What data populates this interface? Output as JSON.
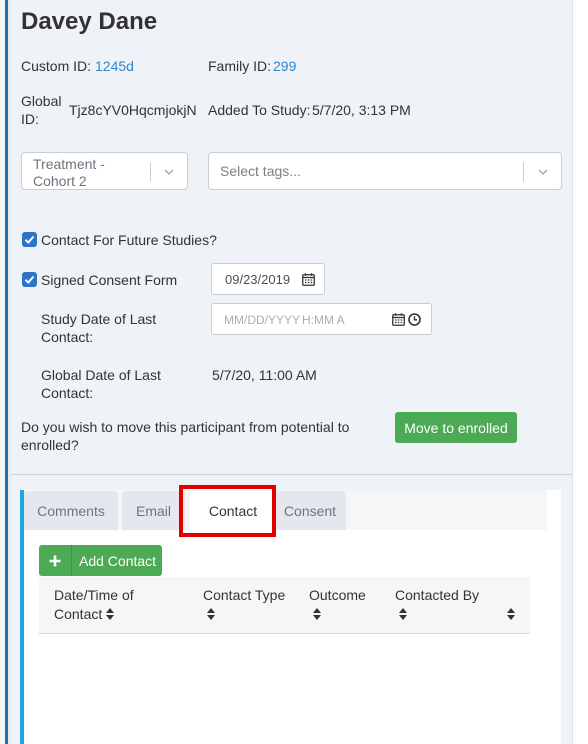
{
  "participant": {
    "name": "Davey Dane",
    "custom_id_label": "Custom ID:",
    "custom_id": "1245d",
    "family_id_label": "Family ID:",
    "family_id": "299",
    "global_id_label_1": "Global",
    "global_id_label_2": "ID:",
    "global_id": "Tjz8cYV0HqcmjokjN",
    "added_label": "Added To Study:",
    "added_value": "5/7/20, 3:13 PM"
  },
  "cohort_select": {
    "line1": "Treatment -",
    "line2": "Cohort 2"
  },
  "tags_select": {
    "placeholder": "Select tags..."
  },
  "future_studies": {
    "label": "Contact For Future Studies?",
    "checked": true
  },
  "consent": {
    "label": "Signed Consent Form",
    "checked": true,
    "date": "09/23/2019"
  },
  "study_last_contact": {
    "label_1": "Study Date of Last",
    "label_2": "Contact:",
    "date_placeholder": "MM/DD/YYYY",
    "time_placeholder": "H:MM A"
  },
  "global_last_contact": {
    "label_1": "Global Date of Last",
    "label_2": "Contact:",
    "value": "5/7/20, 11:00 AM"
  },
  "move_prompt": {
    "line1": "Do you wish to move this participant from potential to",
    "line2": "enrolled?",
    "button": "Move to enrolled"
  },
  "tabs": [
    {
      "label": "Comments",
      "active": false
    },
    {
      "label": "Email",
      "active": false
    },
    {
      "label": "Contact",
      "active": true
    },
    {
      "label": "Consent",
      "active": false
    }
  ],
  "add_contact_label": "Add Contact",
  "table_headers": {
    "datetime_1": "Date/Time of",
    "datetime_2": "Contact",
    "type": "Contact Type",
    "outcome": "Outcome",
    "contacted_by": "Contacted By"
  },
  "colors": {
    "accent": "#1f6fb5",
    "link": "#2b87d1",
    "success": "#4caa54",
    "highlight": "#e00000",
    "tab_accent": "#1ea5e0"
  }
}
